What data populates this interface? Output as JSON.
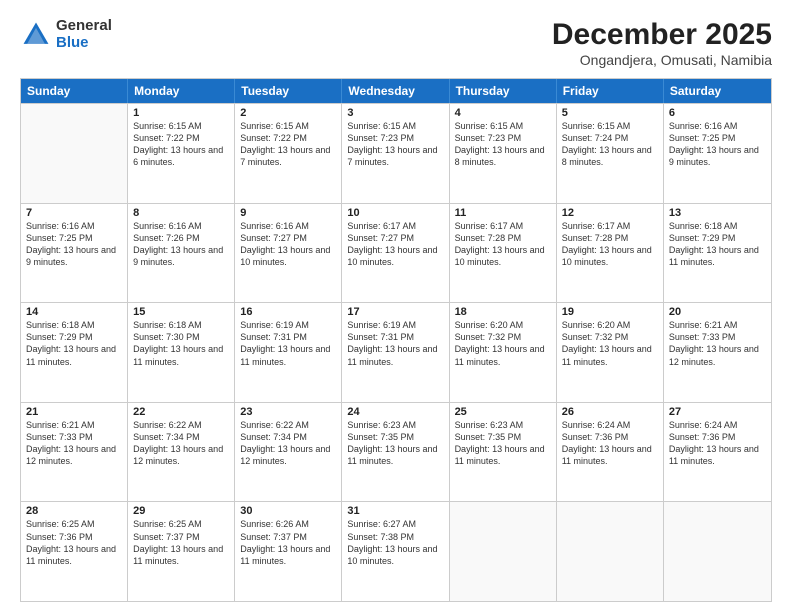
{
  "header": {
    "logo_general": "General",
    "logo_blue": "Blue",
    "month_title": "December 2025",
    "location": "Ongandjera, Omusati, Namibia"
  },
  "days_of_week": [
    "Sunday",
    "Monday",
    "Tuesday",
    "Wednesday",
    "Thursday",
    "Friday",
    "Saturday"
  ],
  "weeks": [
    [
      {
        "day": "",
        "empty": true
      },
      {
        "day": "1",
        "sunrise": "Sunrise: 6:15 AM",
        "sunset": "Sunset: 7:22 PM",
        "daylight": "Daylight: 13 hours and 6 minutes."
      },
      {
        "day": "2",
        "sunrise": "Sunrise: 6:15 AM",
        "sunset": "Sunset: 7:22 PM",
        "daylight": "Daylight: 13 hours and 7 minutes."
      },
      {
        "day": "3",
        "sunrise": "Sunrise: 6:15 AM",
        "sunset": "Sunset: 7:23 PM",
        "daylight": "Daylight: 13 hours and 7 minutes."
      },
      {
        "day": "4",
        "sunrise": "Sunrise: 6:15 AM",
        "sunset": "Sunset: 7:23 PM",
        "daylight": "Daylight: 13 hours and 8 minutes."
      },
      {
        "day": "5",
        "sunrise": "Sunrise: 6:15 AM",
        "sunset": "Sunset: 7:24 PM",
        "daylight": "Daylight: 13 hours and 8 minutes."
      },
      {
        "day": "6",
        "sunrise": "Sunrise: 6:16 AM",
        "sunset": "Sunset: 7:25 PM",
        "daylight": "Daylight: 13 hours and 9 minutes."
      }
    ],
    [
      {
        "day": "7",
        "sunrise": "Sunrise: 6:16 AM",
        "sunset": "Sunset: 7:25 PM",
        "daylight": "Daylight: 13 hours and 9 minutes."
      },
      {
        "day": "8",
        "sunrise": "Sunrise: 6:16 AM",
        "sunset": "Sunset: 7:26 PM",
        "daylight": "Daylight: 13 hours and 9 minutes."
      },
      {
        "day": "9",
        "sunrise": "Sunrise: 6:16 AM",
        "sunset": "Sunset: 7:27 PM",
        "daylight": "Daylight: 13 hours and 10 minutes."
      },
      {
        "day": "10",
        "sunrise": "Sunrise: 6:17 AM",
        "sunset": "Sunset: 7:27 PM",
        "daylight": "Daylight: 13 hours and 10 minutes."
      },
      {
        "day": "11",
        "sunrise": "Sunrise: 6:17 AM",
        "sunset": "Sunset: 7:28 PM",
        "daylight": "Daylight: 13 hours and 10 minutes."
      },
      {
        "day": "12",
        "sunrise": "Sunrise: 6:17 AM",
        "sunset": "Sunset: 7:28 PM",
        "daylight": "Daylight: 13 hours and 10 minutes."
      },
      {
        "day": "13",
        "sunrise": "Sunrise: 6:18 AM",
        "sunset": "Sunset: 7:29 PM",
        "daylight": "Daylight: 13 hours and 11 minutes."
      }
    ],
    [
      {
        "day": "14",
        "sunrise": "Sunrise: 6:18 AM",
        "sunset": "Sunset: 7:29 PM",
        "daylight": "Daylight: 13 hours and 11 minutes."
      },
      {
        "day": "15",
        "sunrise": "Sunrise: 6:18 AM",
        "sunset": "Sunset: 7:30 PM",
        "daylight": "Daylight: 13 hours and 11 minutes."
      },
      {
        "day": "16",
        "sunrise": "Sunrise: 6:19 AM",
        "sunset": "Sunset: 7:31 PM",
        "daylight": "Daylight: 13 hours and 11 minutes."
      },
      {
        "day": "17",
        "sunrise": "Sunrise: 6:19 AM",
        "sunset": "Sunset: 7:31 PM",
        "daylight": "Daylight: 13 hours and 11 minutes."
      },
      {
        "day": "18",
        "sunrise": "Sunrise: 6:20 AM",
        "sunset": "Sunset: 7:32 PM",
        "daylight": "Daylight: 13 hours and 11 minutes."
      },
      {
        "day": "19",
        "sunrise": "Sunrise: 6:20 AM",
        "sunset": "Sunset: 7:32 PM",
        "daylight": "Daylight: 13 hours and 11 minutes."
      },
      {
        "day": "20",
        "sunrise": "Sunrise: 6:21 AM",
        "sunset": "Sunset: 7:33 PM",
        "daylight": "Daylight: 13 hours and 12 minutes."
      }
    ],
    [
      {
        "day": "21",
        "sunrise": "Sunrise: 6:21 AM",
        "sunset": "Sunset: 7:33 PM",
        "daylight": "Daylight: 13 hours and 12 minutes."
      },
      {
        "day": "22",
        "sunrise": "Sunrise: 6:22 AM",
        "sunset": "Sunset: 7:34 PM",
        "daylight": "Daylight: 13 hours and 12 minutes."
      },
      {
        "day": "23",
        "sunrise": "Sunrise: 6:22 AM",
        "sunset": "Sunset: 7:34 PM",
        "daylight": "Daylight: 13 hours and 12 minutes."
      },
      {
        "day": "24",
        "sunrise": "Sunrise: 6:23 AM",
        "sunset": "Sunset: 7:35 PM",
        "daylight": "Daylight: 13 hours and 11 minutes."
      },
      {
        "day": "25",
        "sunrise": "Sunrise: 6:23 AM",
        "sunset": "Sunset: 7:35 PM",
        "daylight": "Daylight: 13 hours and 11 minutes."
      },
      {
        "day": "26",
        "sunrise": "Sunrise: 6:24 AM",
        "sunset": "Sunset: 7:36 PM",
        "daylight": "Daylight: 13 hours and 11 minutes."
      },
      {
        "day": "27",
        "sunrise": "Sunrise: 6:24 AM",
        "sunset": "Sunset: 7:36 PM",
        "daylight": "Daylight: 13 hours and 11 minutes."
      }
    ],
    [
      {
        "day": "28",
        "sunrise": "Sunrise: 6:25 AM",
        "sunset": "Sunset: 7:36 PM",
        "daylight": "Daylight: 13 hours and 11 minutes."
      },
      {
        "day": "29",
        "sunrise": "Sunrise: 6:25 AM",
        "sunset": "Sunset: 7:37 PM",
        "daylight": "Daylight: 13 hours and 11 minutes."
      },
      {
        "day": "30",
        "sunrise": "Sunrise: 6:26 AM",
        "sunset": "Sunset: 7:37 PM",
        "daylight": "Daylight: 13 hours and 11 minutes."
      },
      {
        "day": "31",
        "sunrise": "Sunrise: 6:27 AM",
        "sunset": "Sunset: 7:38 PM",
        "daylight": "Daylight: 13 hours and 10 minutes."
      },
      {
        "day": "",
        "empty": true
      },
      {
        "day": "",
        "empty": true
      },
      {
        "day": "",
        "empty": true
      }
    ]
  ]
}
